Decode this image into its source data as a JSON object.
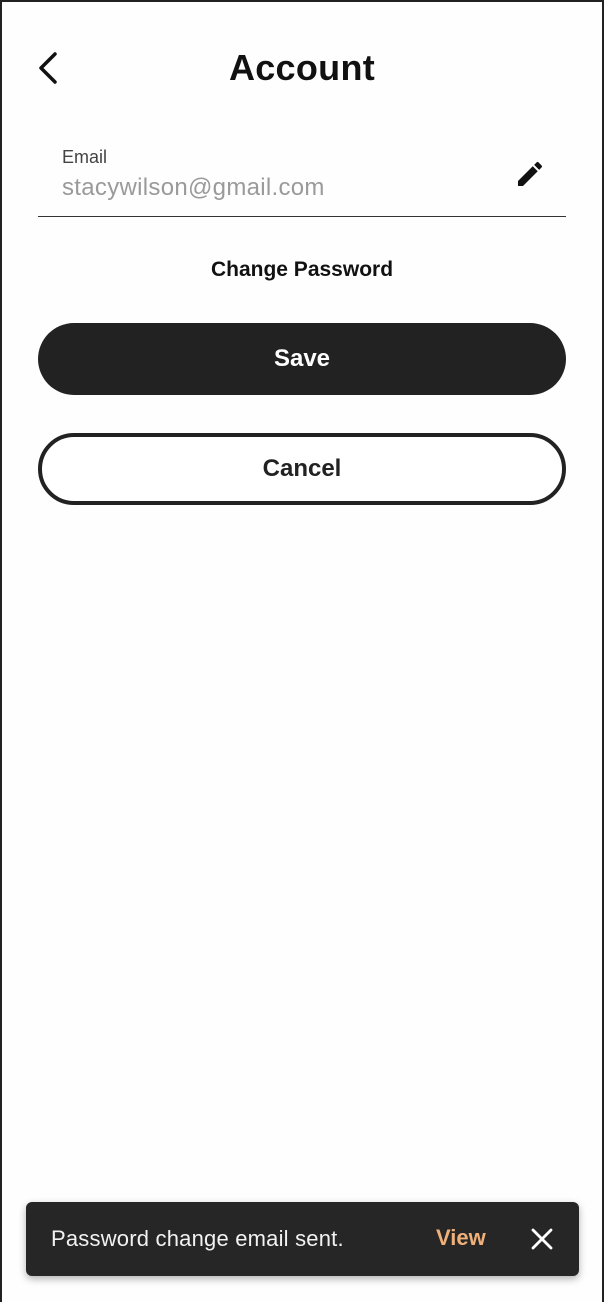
{
  "header": {
    "title": "Account",
    "back_icon": "chevron-left-icon"
  },
  "email": {
    "label": "Email",
    "value": "stacywilson@gmail.com",
    "edit_icon": "pencil-icon"
  },
  "actions": {
    "change_password": "Change Password",
    "save": "Save",
    "cancel": "Cancel"
  },
  "snackbar": {
    "message": "Password change email sent.",
    "action": "View",
    "close_icon": "close-icon"
  },
  "colors": {
    "primary": "#222222",
    "snackbar_bg": "#262626",
    "snackbar_action": "#f0b07a",
    "placeholder_text": "#9a9a9a"
  }
}
